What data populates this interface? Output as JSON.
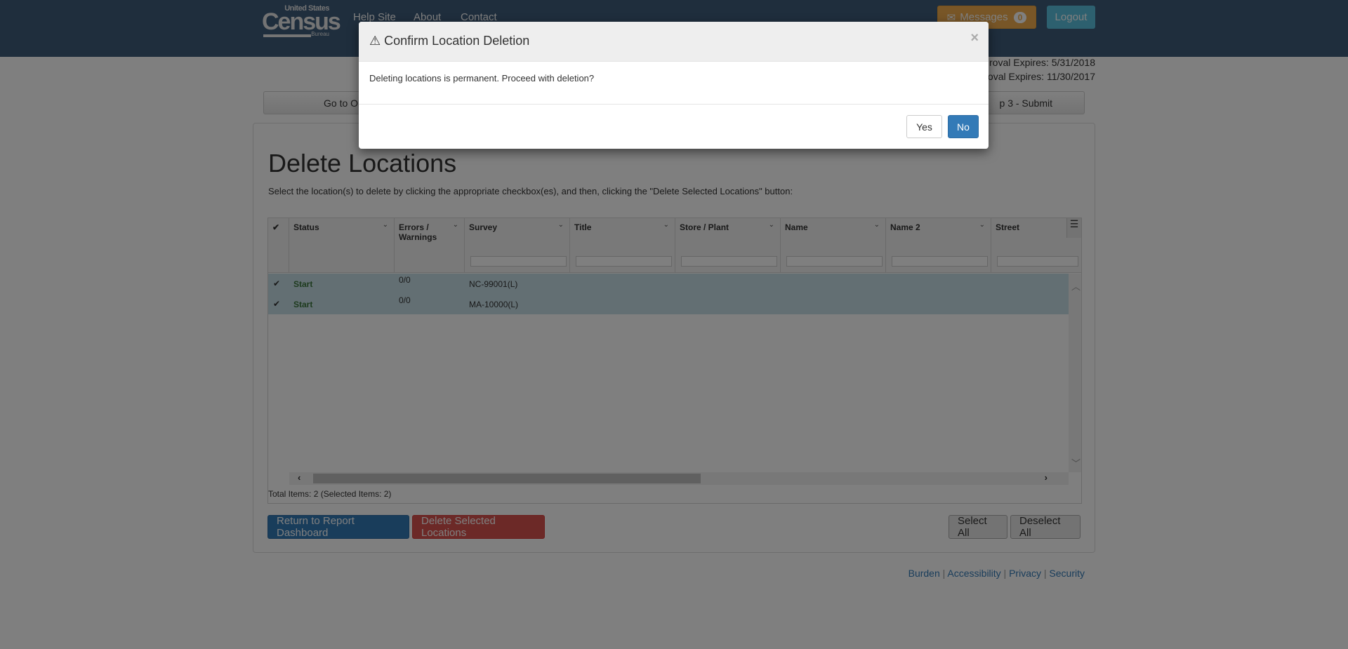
{
  "header": {
    "logo": {
      "line1": "United States",
      "line2": "Census",
      "line3": "Bureau"
    },
    "nav": [
      "Help Site",
      "About",
      "Contact"
    ],
    "messages_label": "Messages",
    "messages_count": "0",
    "logout_label": "Logout"
  },
  "approval": [
    "roval Expires: 5/31/2018",
    "roval Expires: 11/30/2017"
  ],
  "steps": {
    "left": "Go to O",
    "right": "p 3 - Submit"
  },
  "page": {
    "title": "Delete Locations",
    "instructions": "Select the location(s) to delete by clicking the appropriate checkbox(es), and then, clicking the \"Delete Selected Locations\" button:"
  },
  "grid": {
    "columns": [
      "Status",
      "Errors / Warnings",
      "Survey",
      "Title",
      "Store / Plant",
      "Name",
      "Name 2",
      "Street"
    ],
    "rows": [
      {
        "status": "Start",
        "errors": "0/0",
        "survey": "NC-99001(L)",
        "selected": true
      },
      {
        "status": "Start",
        "errors": "0/0",
        "survey": "MA-10000(L)",
        "selected": true
      }
    ],
    "total": "Total Items: 2 (Selected Items: 2)",
    "status_color": "#3c763d",
    "selected_row_color": "#c6dfe7"
  },
  "buttons": {
    "return": "Return to Report Dashboard",
    "delete": "Delete Selected Locations",
    "select_all": "Select All",
    "deselect_all": "Deselect All"
  },
  "footer": [
    "Burden",
    "Accessibility",
    "Privacy",
    "Security"
  ],
  "modal": {
    "title": "Confirm Location Deletion",
    "icon": "warning-icon",
    "body": "Deleting locations is permanent. Proceed with deletion?",
    "yes": "Yes",
    "no": "No",
    "close": "×"
  }
}
